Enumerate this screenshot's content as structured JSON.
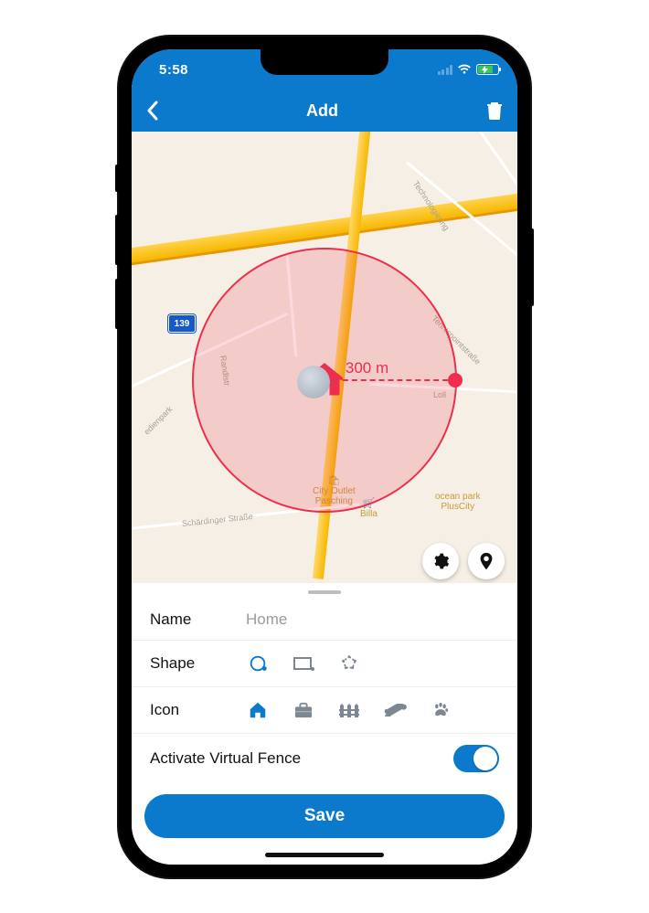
{
  "statusbar": {
    "time": "5:58"
  },
  "nav": {
    "title": "Add"
  },
  "map": {
    "route_number": "139",
    "radius_label": "300 m",
    "poi1": "City Outlet\nPasching",
    "poi2": "Billa",
    "poi3": "ocean park\nPlusCity",
    "road_label1": "Randlstr",
    "road_label2": "Loll",
    "road_label3": "Tennispointstraße",
    "road_label4": "Technologiering",
    "road_label5": "Schärdinger Straße",
    "road_label6": "edienpark"
  },
  "form": {
    "name_label": "Name",
    "name_placeholder": "Home",
    "shape_label": "Shape",
    "icon_label": "Icon",
    "activate_label": "Activate Virtual Fence",
    "save_label": "Save"
  }
}
